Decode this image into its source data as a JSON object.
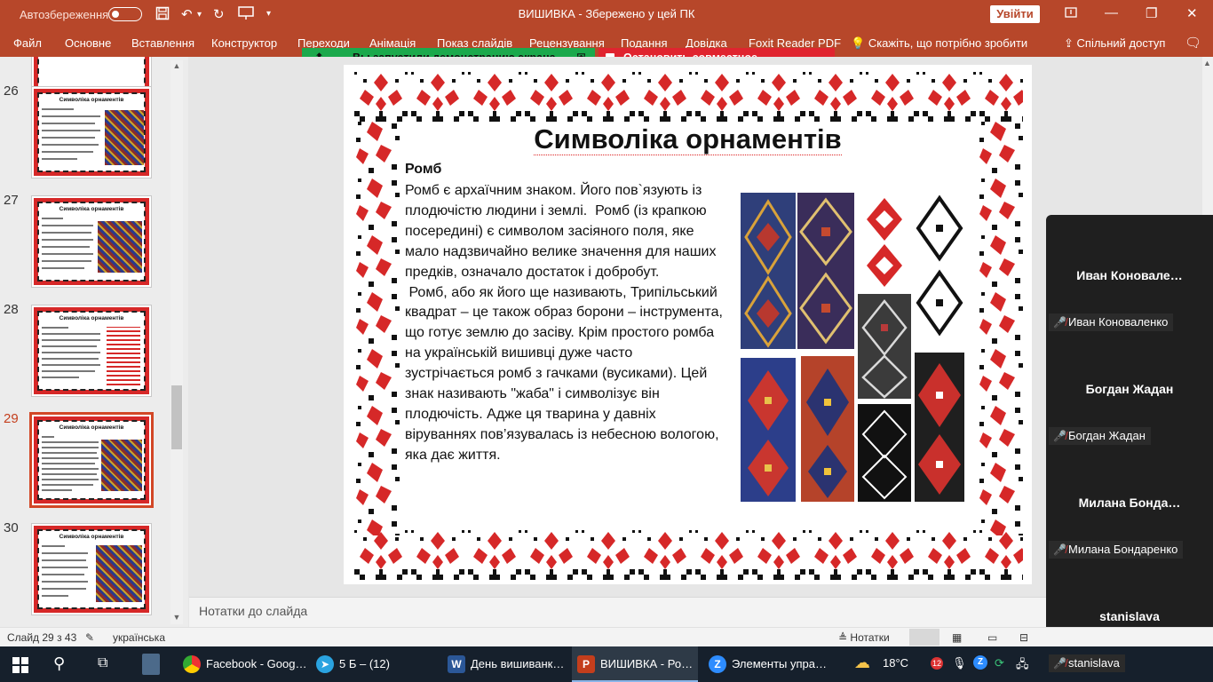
{
  "window": {
    "autosave_label": "Автозбереження",
    "title": "ВИШИВКА  -  Збережено у цей ПК",
    "signin_label": "Увійти"
  },
  "ribbon": {
    "tabs": [
      "Файл",
      "Основне",
      "Вставлення",
      "Конструктор",
      "Переходи",
      "Анімація",
      "Показ слайдів",
      "Рецензування",
      "Подання",
      "Довідка",
      "Foxit Reader PDF"
    ],
    "tell_me": "Скажіть, що потрібно зробити",
    "share": "Спільний доступ"
  },
  "screen_share": {
    "active_message": "Вы запустили демонстрацию экрана",
    "stop_label": "Остановить совместное использование"
  },
  "thumbnails": [
    {
      "number": "26",
      "title": "Символіка орнаментів"
    },
    {
      "number": "27",
      "title": "Символіка орнаментів"
    },
    {
      "number": "28",
      "title": "Символіка орнаментів"
    },
    {
      "number": "29",
      "title": "Символіка орнаментів",
      "selected": true
    },
    {
      "number": "30",
      "title": "Символіка орнаментів"
    }
  ],
  "slide": {
    "title": "Символіка орнаментів",
    "subtitle": "Ромб",
    "body": "Ромб є архаїчним знаком. Його пов`язують із плодючістю людини і землі.  Ромб (із крапкою посередині) є символом засіяного поля, яке мало надзвичайно велике значення для наших предків, означало достаток і добробут.\n Ромб, або як його ще називають, Трипільський квадрат – це також образ борони – інструмента, що готує землю до засіву. Крім простого ромба на українській вишивці дуже часто зустрічається ромб з гачками (вусиками). Цей знак називають \"жаба\" і символізує він плодючість. Адже ця тварина у давніх віруваннях пов’язувалась із небесною вологою, яка дає життя."
  },
  "notes_placeholder": "Нотатки до слайда",
  "participants": [
    {
      "display": "Иван  Коновале…",
      "tag": "Иван Коноваленко"
    },
    {
      "display": "Богдан Жадан",
      "tag": "Богдан Жадан"
    },
    {
      "display": "Милана  Бонда…",
      "tag": "Милана Бондаренко"
    },
    {
      "display": "stanislava",
      "tag": "stanislava"
    }
  ],
  "status": {
    "slide_counter": "Слайд 29 з 43",
    "language": "українська",
    "notes_label": "Нотатки"
  },
  "taskbar": {
    "apps": [
      {
        "label": "Facebook - Goog…"
      },
      {
        "label": "5 Б – (12)",
        "badge": "12"
      },
      {
        "label": "День вишиванк…"
      },
      {
        "label": "ВИШИВКА - Ро…"
      },
      {
        "label": "Элементы упра…"
      }
    ],
    "weather": "18°C",
    "tray_badge": "12"
  },
  "colors": {
    "accent": "#b7472a",
    "share_green": "#1ba94c",
    "share_red": "#e0242f",
    "embroidery_red": "#d62828",
    "embroidery_black": "#111111"
  }
}
